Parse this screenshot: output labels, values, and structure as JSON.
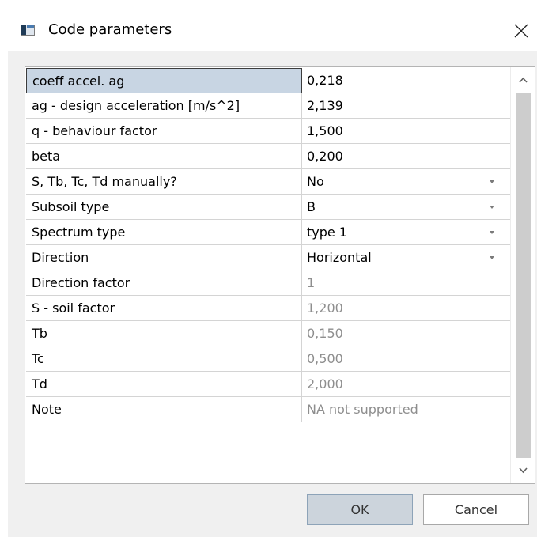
{
  "window": {
    "title": "Code parameters",
    "app_icon": "dialog-app-icon",
    "close_icon": "close-icon"
  },
  "grid": {
    "rows": [
      {
        "label": "coeff accel. ag",
        "value": "0,218",
        "dropdown": false,
        "disabled": false,
        "selected": true
      },
      {
        "label": "ag - design acceleration [m/s^2]",
        "value": "2,139",
        "dropdown": false,
        "disabled": false,
        "selected": false
      },
      {
        "label": "q - behaviour factor",
        "value": "1,500",
        "dropdown": false,
        "disabled": false,
        "selected": false
      },
      {
        "label": "beta",
        "value": "0,200",
        "dropdown": false,
        "disabled": false,
        "selected": false
      },
      {
        "label": "S, Tb, Tc, Td manually?",
        "value": "No",
        "dropdown": true,
        "disabled": false,
        "selected": false
      },
      {
        "label": "Subsoil type",
        "value": "B",
        "dropdown": true,
        "disabled": false,
        "selected": false
      },
      {
        "label": "Spectrum type",
        "value": "type 1",
        "dropdown": true,
        "disabled": false,
        "selected": false
      },
      {
        "label": "Direction",
        "value": "Horizontal",
        "dropdown": true,
        "disabled": false,
        "selected": false
      },
      {
        "label": "Direction factor",
        "value": "1",
        "dropdown": false,
        "disabled": true,
        "selected": false
      },
      {
        "label": "S - soil factor",
        "value": "1,200",
        "dropdown": false,
        "disabled": true,
        "selected": false
      },
      {
        "label": "Tb",
        "value": "0,150",
        "dropdown": false,
        "disabled": true,
        "selected": false
      },
      {
        "label": "Tc",
        "value": "0,500",
        "dropdown": false,
        "disabled": true,
        "selected": false
      },
      {
        "label": "Td",
        "value": "2,000",
        "dropdown": false,
        "disabled": true,
        "selected": false
      },
      {
        "label": "Note",
        "value": "NA not supported",
        "dropdown": false,
        "disabled": true,
        "selected": false
      }
    ]
  },
  "buttons": {
    "ok_label": "OK",
    "cancel_label": "Cancel"
  },
  "colors": {
    "selected_label_bg": "#c8d5e3",
    "disabled_text": "#8e8e8e",
    "ok_button_bg": "#ccd4dc"
  }
}
